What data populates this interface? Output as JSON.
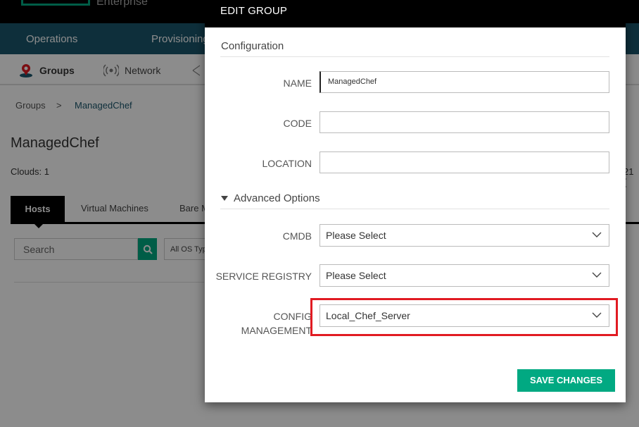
{
  "background": {
    "brand": "Enterprise",
    "nav": [
      "Operations",
      "Provisioning"
    ],
    "subnav": [
      "Groups",
      "Network"
    ],
    "breadcrumb": {
      "root": "Groups",
      "separator": ">",
      "current": "ManagedChef"
    },
    "page_title": "ManagedChef",
    "clouds": "Clouds: 1",
    "right_fragment": "21 (",
    "tabs": [
      "Hosts",
      "Virtual Machines",
      "Bare M"
    ],
    "search_placeholder": "Search",
    "os_filter": "All OS Typ"
  },
  "modal": {
    "title": "EDIT GROUP",
    "configuration_title": "Configuration",
    "name_label": "NAME",
    "name_value": "ManagedChef",
    "code_label": "CODE",
    "code_value": "",
    "location_label": "LOCATION",
    "location_value": "",
    "advanced_title": "Advanced Options",
    "cmdb_label": "CMDB",
    "cmdb_value": "Please Select",
    "service_registry_label": "SERVICE REGISTRY",
    "service_registry_value": "Please Select",
    "config_label_1": "CONFIG",
    "config_label_2": "MANAGEMENT",
    "config_value": "Local_Chef_Server",
    "save_label": "SAVE CHANGES"
  },
  "colors": {
    "accent": "#01a982",
    "navbar": "#1a566c",
    "highlight": "#e11b22"
  }
}
